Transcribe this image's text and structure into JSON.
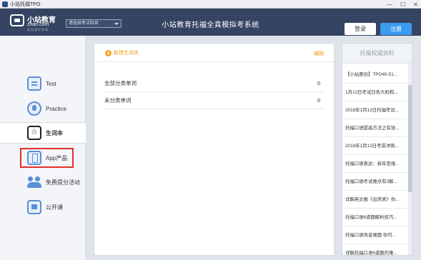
{
  "window": {
    "title": "小站托福TPO",
    "controls": [
      "—",
      "☐",
      "✕"
    ]
  },
  "header": {
    "logo_cn": "小站教育",
    "logo_en": "zhan.com",
    "logo_slogan": "发现更好的你",
    "exam_select": "请选择考试科目",
    "app_title": "小站教育托福全真模拟考系统",
    "login_label": "登录",
    "register_label": "注册"
  },
  "sidebar": {
    "items": [
      {
        "label": "Test",
        "icon": "test-icon"
      },
      {
        "label": "Practice",
        "icon": "practice-icon"
      },
      {
        "label": "生词本",
        "icon": "vocab-icon"
      },
      {
        "label": "App产品",
        "icon": "app-icon"
      },
      {
        "label": "免费提分活动",
        "icon": "activity-icon"
      },
      {
        "label": "公开课",
        "icon": "course-icon"
      }
    ],
    "active_index": 2,
    "highlight_color": "#e0302b"
  },
  "main": {
    "new_vocab_label": "新建生词本",
    "edit_label": "编辑",
    "vocab_lists": [
      {
        "name": "全部分类单词",
        "count": "0"
      },
      {
        "name": "未分类单词",
        "count": "0"
      }
    ]
  },
  "right_panel": {
    "title": "托福权威资料",
    "items": [
      "【小站原创】TPO40-51...",
      "1月13日考试日各大机构...",
      "2018年1月13日托福考试...",
      "托福口语提高方法之有效...",
      "2018年1月13日考前冲刺...",
      "托福口语表达：拆年思维...",
      "托福口语考试难点有3解...",
      "详解英文报《出席表》你...",
      "托福口语6道题解析技巧...",
      "托福口语攻音难题 你可...",
      "详解托福口语6道题的难..."
    ]
  },
  "colors": {
    "header_bg": "#344462",
    "accent_orange": "#f39a1e",
    "register_blue": "#3a9bf0"
  }
}
